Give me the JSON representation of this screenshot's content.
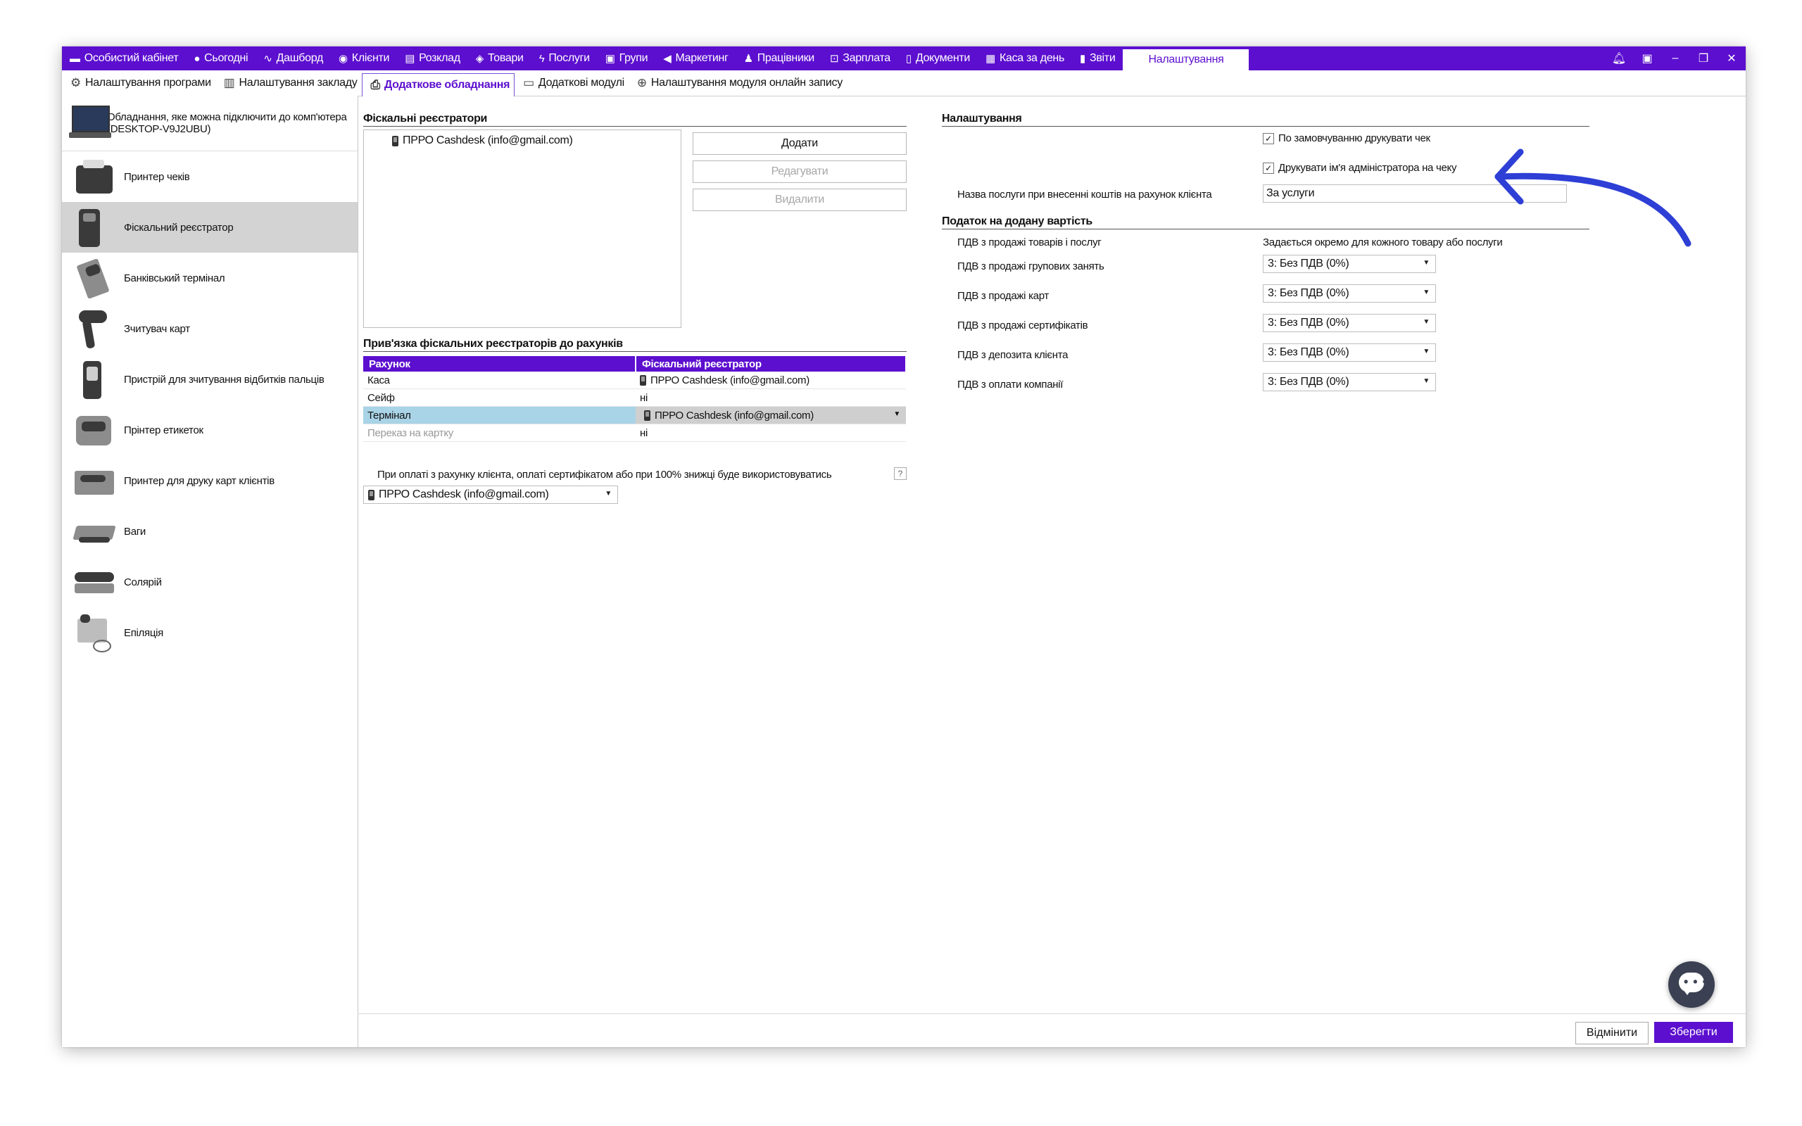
{
  "topnav": [
    {
      "label": "Особистий кабінет",
      "icon": "wallet-icon"
    },
    {
      "label": "Сьогодні",
      "icon": "circle-icon"
    },
    {
      "label": "Дашборд",
      "icon": "pulse-icon"
    },
    {
      "label": "Клієнти",
      "icon": "user-circle-icon"
    },
    {
      "label": "Розклад",
      "icon": "calendar-icon"
    },
    {
      "label": "Товари",
      "icon": "box-icon"
    },
    {
      "label": "Послуги",
      "icon": "lightning-icon"
    },
    {
      "label": "Групи",
      "icon": "group-icon"
    },
    {
      "label": "Маркетинг",
      "icon": "megaphone-icon"
    },
    {
      "label": "Працівники",
      "icon": "person-icon"
    },
    {
      "label": "Зарплата",
      "icon": "cash-icon"
    },
    {
      "label": "Документи",
      "icon": "document-icon"
    },
    {
      "label": "Каса за день",
      "icon": "calculator-icon"
    },
    {
      "label": "Звіти",
      "icon": "bar-chart-icon"
    },
    {
      "label": "Налаштування",
      "icon": ""
    }
  ],
  "subtabs": [
    {
      "label": "Налаштування програми",
      "icon": "gear-icon"
    },
    {
      "label": "Налаштування закладу",
      "icon": "building-icon"
    },
    {
      "label": "Додаткове обладнання",
      "icon": "printer-icon"
    },
    {
      "label": "Додаткові модулі",
      "icon": "module-icon"
    },
    {
      "label": "Налаштування модуля онлайн запису",
      "icon": "globe-icon"
    }
  ],
  "left": {
    "pc_info": "Обладнання, яке можна підключити до комп'ютера (DESKTOP-V9J2UBU)",
    "devices": [
      "Принтер чеків",
      "Фіскальний реєстратор",
      "Банківський термінал",
      "Зчитувач карт",
      "Пристрій для зчитування відбитків пальців",
      "Прінтер етикеток",
      "Принтер для друку карт клієнтів",
      "Ваги",
      "Солярій",
      "Епіляція"
    ]
  },
  "center": {
    "fiscal_header": "Фіскальні реєстратори",
    "fiscal_items": [
      "ПРРО Cashdesk (info@gmail.com)"
    ],
    "add_btn": "Додати",
    "edit_btn": "Редагувати",
    "delete_btn": "Видалити",
    "binding_header": "Прив'язка фіскальних реєстраторів до рахунків",
    "table_headers": [
      "Рахунок",
      "Фіскальний реєстратор"
    ],
    "rows": [
      [
        "Каса",
        "ПРРО Cashdesk (info@gmail.com)"
      ],
      [
        "Сейф",
        "ні"
      ],
      [
        "Термінал",
        "ПРРО Cashdesk (info@gmail.com)"
      ],
      [
        "Переказ на картку",
        "ні"
      ]
    ],
    "pay_note": "При оплаті з рахунку клієнта, оплаті сертифікатом або при 100% знижці буде використовуватись",
    "help": "?",
    "pay_select": "ПРРО Cashdesk (info@gmail.com)"
  },
  "right": {
    "settings_header": "Налаштування",
    "chk1": "По замовчуванню друкувати чек",
    "chk2": "Друкувати ім'я адміністратора на чеку",
    "check_mark": "✓",
    "service_label": "Назва послуги при внесенні коштів на рахунок клієнта",
    "service_value": "За услуги",
    "vat_header": "Податок на додану вартість",
    "vat_goods_label": "ПДВ з продажі товарів і послуг",
    "vat_goods_value": "Задається окремо для кожного товару або послуги",
    "vat_rows": [
      {
        "label": "ПДВ з продажі групових занять",
        "value": "3: Без ПДВ (0%)"
      },
      {
        "label": "ПДВ з продажі карт",
        "value": "3: Без ПДВ (0%)"
      },
      {
        "label": "ПДВ з продажі сертифікатів",
        "value": "3: Без ПДВ (0%)"
      },
      {
        "label": "ПДВ з депозита клієнта",
        "value": "3: Без ПДВ (0%)"
      },
      {
        "label": "ПДВ з оплати компанії",
        "value": "3: Без ПДВ (0%)"
      }
    ]
  },
  "footer": {
    "cancel": "Відмінити",
    "save": "Зберегти"
  },
  "colors": {
    "accent": "#5c0fcf",
    "arrow": "#2e3fd6",
    "selection": "#a9d3e6"
  }
}
